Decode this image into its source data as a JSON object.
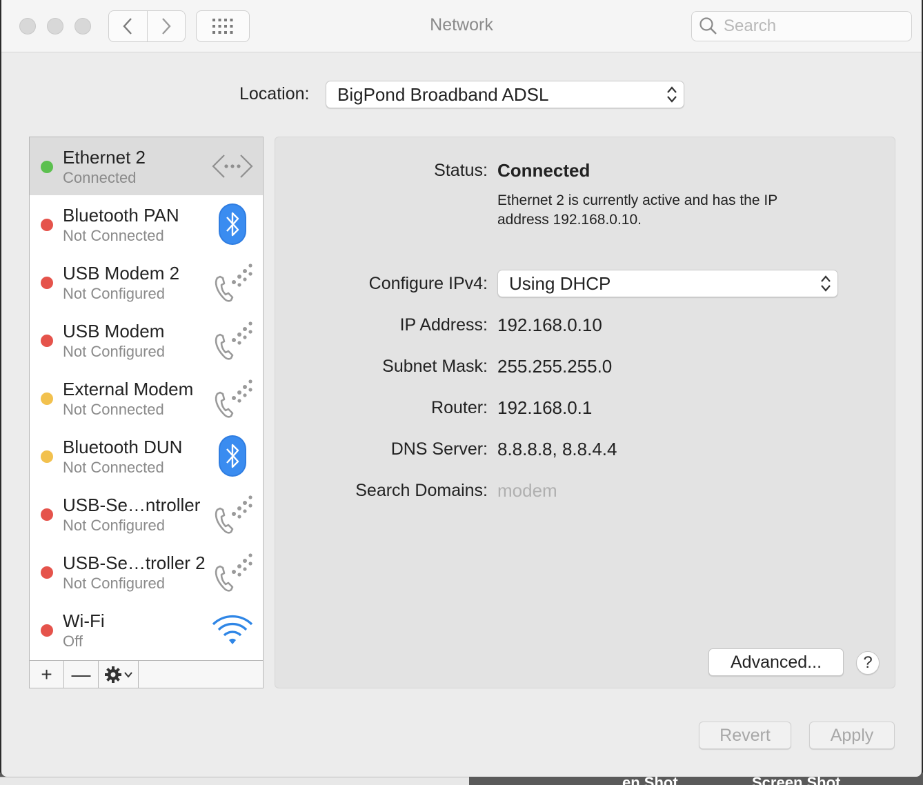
{
  "window": {
    "title": "Network",
    "search_placeholder": "Search"
  },
  "location": {
    "label": "Location:",
    "value": "BigPond Broadband ADSL"
  },
  "services": [
    {
      "name": "Ethernet 2",
      "status": "Connected",
      "dot": "#5cc04f",
      "icon": "ethernet-icon",
      "selected": true
    },
    {
      "name": "Bluetooth PAN",
      "status": "Not Connected",
      "dot": "#e5534b",
      "icon": "bluetooth-icon"
    },
    {
      "name": "USB Modem 2",
      "status": "Not Configured",
      "dot": "#e5534b",
      "icon": "phone-icon"
    },
    {
      "name": "USB Modem",
      "status": "Not Configured",
      "dot": "#e5534b",
      "icon": "phone-icon"
    },
    {
      "name": "External Modem",
      "status": "Not Connected",
      "dot": "#f2c14e",
      "icon": "phone-icon"
    },
    {
      "name": "Bluetooth DUN",
      "status": "Not Connected",
      "dot": "#f2c14e",
      "icon": "bluetooth-icon"
    },
    {
      "name": "USB-Se…ntroller",
      "status": "Not Configured",
      "dot": "#e5534b",
      "icon": "phone-icon"
    },
    {
      "name": "USB-Se…troller 2",
      "status": "Not Configured",
      "dot": "#e5534b",
      "icon": "phone-icon"
    },
    {
      "name": "Wi-Fi",
      "status": "Off",
      "dot": "#e5534b",
      "icon": "wifi-icon"
    }
  ],
  "toolbar": {
    "add": "+",
    "remove": "—"
  },
  "details": {
    "status_label": "Status:",
    "status_value": "Connected",
    "status_description": "Ethernet 2 is currently active and has the IP address 192.168.0.10.",
    "configure_label": "Configure IPv4:",
    "configure_value": "Using DHCP",
    "ip_label": "IP Address:",
    "ip_value": "192.168.0.10",
    "subnet_label": "Subnet Mask:",
    "subnet_value": "255.255.255.0",
    "router_label": "Router:",
    "router_value": "192.168.0.1",
    "dns_label": "DNS Server:",
    "dns_value": "8.8.8.8, 8.8.4.4",
    "domains_label": "Search Domains:",
    "domains_value": "modem"
  },
  "buttons": {
    "advanced": "Advanced...",
    "help": "?",
    "revert": "Revert",
    "apply": "Apply"
  },
  "desktop": {
    "thumb1": "en Shot",
    "thumb2": "Screen Shot"
  }
}
